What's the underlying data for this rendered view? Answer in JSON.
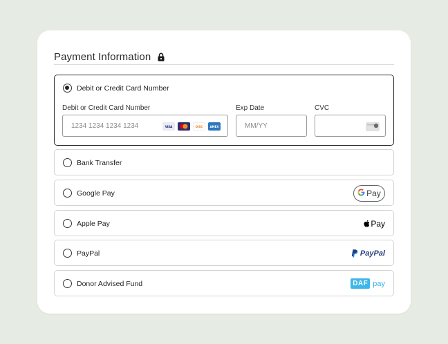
{
  "header": {
    "title": "Payment Information",
    "lock_icon": "lock-icon"
  },
  "card_option": {
    "label": "Debit or Credit Card Number",
    "selected": true,
    "fields": {
      "card_number": {
        "label": "Debit or Credit Card Number",
        "placeholder": "1234 1234 1234 1234",
        "value": ""
      },
      "exp_date": {
        "label": "Exp Date",
        "placeholder": "MM/YY",
        "value": ""
      },
      "cvc": {
        "label": "CVC",
        "placeholder": "",
        "value": "",
        "icon": "cvc-card-icon"
      }
    },
    "card_brands": [
      "visa-icon",
      "mastercard-icon",
      "discover-icon",
      "amex-icon"
    ]
  },
  "options": [
    {
      "label": "Bank Transfer",
      "brand": ""
    },
    {
      "label": "Google Pay",
      "brand_text": "Pay"
    },
    {
      "label": "Apple Pay",
      "brand_text": "Pay"
    },
    {
      "label": "PayPal",
      "brand_text": "PayPal"
    },
    {
      "label": "Donor Advised Fund",
      "brand_box": "DAF",
      "brand_text": "pay"
    }
  ],
  "colors": {
    "background": "#e6ece3",
    "card": "#ffffff",
    "daf_blue": "#3fb6e8",
    "paypal_dark": "#253b80",
    "paypal_light": "#179bd7"
  }
}
